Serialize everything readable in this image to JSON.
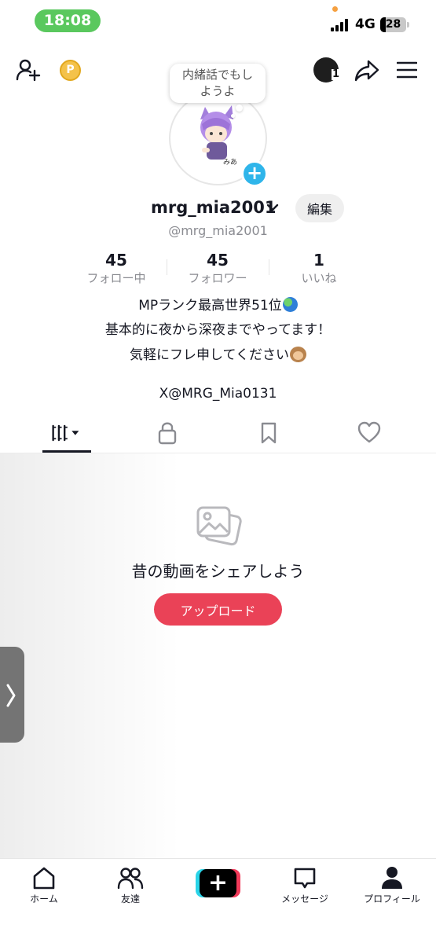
{
  "status_bar": {
    "time": "18:08",
    "network": "4G",
    "battery": "28"
  },
  "top_bar": {
    "coin_letter": "P",
    "avatar_badge": "1"
  },
  "profile": {
    "bubble_text_line1": "内緒話でもし",
    "bubble_text_line2": "ようよ",
    "avatar_caption": "みあ",
    "display_name": "mrg_mia2001",
    "edit_label": "編集",
    "username": "@mrg_mia2001"
  },
  "stats": [
    {
      "value": "45",
      "label": "フォロー中"
    },
    {
      "value": "45",
      "label": "フォロワー"
    },
    {
      "value": "1",
      "label": "いいね"
    }
  ],
  "bio": {
    "line1": "MPランク最高世界51位",
    "line2": "基本的に夜から深夜までやってます！",
    "line3": "気軽にフレ申してください",
    "link": "X@MRG_Mia0131"
  },
  "empty_state": {
    "title": "昔の動画をシェアしよう",
    "upload_label": "アップロード"
  },
  "bottom_nav": [
    {
      "label": "ホーム",
      "icon": "home-icon"
    },
    {
      "label": "友達",
      "icon": "friends-icon"
    },
    {
      "label": "",
      "icon": "create-icon"
    },
    {
      "label": "メッセージ",
      "icon": "message-icon"
    },
    {
      "label": "プロフィール",
      "icon": "profile-icon"
    }
  ],
  "colors": {
    "accent": "#ea4257",
    "status_pill": "#5ac85e",
    "add_badge": "#2fb5ea",
    "muted_text": "#8a8b91"
  }
}
